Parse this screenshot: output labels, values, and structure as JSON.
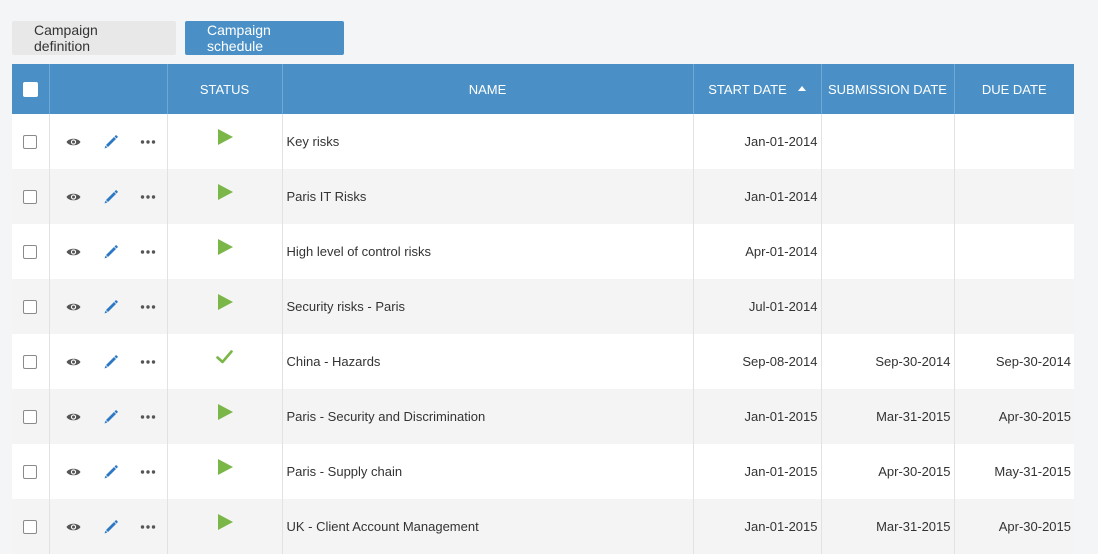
{
  "tabs": {
    "definition": "Campaign definition",
    "schedule": "Campaign schedule"
  },
  "columns": {
    "status": "STATUS",
    "name": "NAME",
    "start_date": "START DATE",
    "submission_date": "SUBMISSION DATE",
    "due_date": "DUE DATE"
  },
  "sort": {
    "column": "start_date",
    "direction": "ascending"
  },
  "colors": {
    "header": "#4a90c6",
    "status_green": "#7ab648",
    "pencil_blue": "#2c78c4"
  },
  "rows": [
    {
      "status": "play-icon",
      "name": "Key risks",
      "start_date": "Jan-01-2014",
      "submission_date": "",
      "due_date": ""
    },
    {
      "status": "play-icon",
      "name": "Paris IT Risks",
      "start_date": "Jan-01-2014",
      "submission_date": "",
      "due_date": ""
    },
    {
      "status": "play-icon",
      "name": "High level of control risks",
      "start_date": "Apr-01-2014",
      "submission_date": "",
      "due_date": ""
    },
    {
      "status": "play-icon",
      "name": "Security risks - Paris",
      "start_date": "Jul-01-2014",
      "submission_date": "",
      "due_date": ""
    },
    {
      "status": "check-icon",
      "name": "China - Hazards",
      "start_date": "Sep-08-2014",
      "submission_date": "Sep-30-2014",
      "due_date": "Sep-30-2014"
    },
    {
      "status": "play-icon",
      "name": "Paris - Security and Discrimination",
      "start_date": "Jan-01-2015",
      "submission_date": "Mar-31-2015",
      "due_date": "Apr-30-2015"
    },
    {
      "status": "play-icon",
      "name": "Paris - Supply chain",
      "start_date": "Jan-01-2015",
      "submission_date": "Apr-30-2015",
      "due_date": "May-31-2015"
    },
    {
      "status": "play-icon",
      "name": "UK - Client Account Management",
      "start_date": "Jan-01-2015",
      "submission_date": "Mar-31-2015",
      "due_date": "Apr-30-2015"
    }
  ]
}
